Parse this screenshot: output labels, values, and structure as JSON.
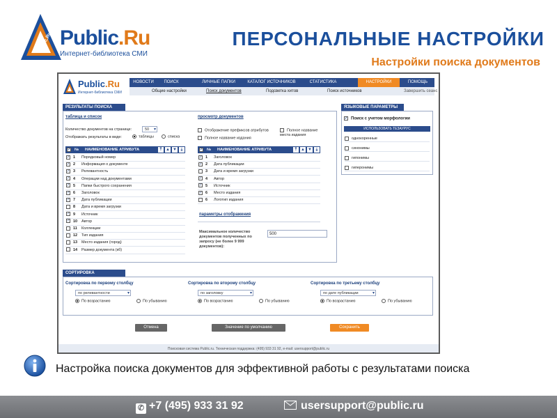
{
  "header": {
    "logo_brand": "Public.Ru",
    "logo_tag": "Public.Ru",
    "logo_subtitle": "Интернет-библиотека СМИ",
    "title": "ПЕРСОНАЛЬНЫЕ НАСТРОЙКИ",
    "subtitle": "Настройки поиска документов"
  },
  "app": {
    "logo_brand": "Public.Ru",
    "logo_subtitle": "Интернет-библиотека СМИ",
    "nav": [
      "НОВОСТИ",
      "ПОИСК",
      "ЛИЧНЫЕ ПАПКИ",
      "КАТАЛОГ ИСТОЧНИКОВ",
      "СТАТИСТИКА",
      "НАСТРОЙКИ",
      "ПОМОЩЬ"
    ],
    "nav_active": "НАСТРОЙКИ",
    "subnav": [
      "Общие настройки",
      "Поиск документов",
      "Подсветка хитов",
      "Поиск источников",
      "Завершить сеанс"
    ],
    "subnav_active": "Поиск документов",
    "results_section": {
      "header": "РЕЗУЛЬТАТЫ ПОИСКА",
      "table_title": "таблица и список",
      "count_label": "Количество документов на странице:",
      "count_value": "50",
      "display_label": "Отображать результаты в виде:",
      "display_options": [
        "таблицы",
        "списка"
      ],
      "display_selected": "таблицы",
      "column_no": "№",
      "column_attr": "НАИМЕНОВАНИЕ АТРИБУТА",
      "rows": [
        {
          "n": "1",
          "name": "Порядковый номер",
          "checked": true
        },
        {
          "n": "2",
          "name": "Информация о документе",
          "checked": true
        },
        {
          "n": "3",
          "name": "Релевантность",
          "checked": true
        },
        {
          "n": "4",
          "name": "Операции над документами",
          "checked": true
        },
        {
          "n": "5",
          "name": "Папки быстрого сохранения",
          "checked": true
        },
        {
          "n": "6",
          "name": "Заголовок",
          "checked": true
        },
        {
          "n": "7",
          "name": "Дата публикации",
          "checked": true
        },
        {
          "n": "8",
          "name": "Дата и время загрузки",
          "checked": false
        },
        {
          "n": "9",
          "name": "Источник",
          "checked": true
        },
        {
          "n": "10",
          "name": "Автор",
          "checked": true
        },
        {
          "n": "11",
          "name": "Коллекции",
          "checked": false
        },
        {
          "n": "12",
          "name": "Тип издания",
          "checked": false
        },
        {
          "n": "13",
          "name": "Место издания (город)",
          "checked": false
        },
        {
          "n": "14",
          "name": "Размер документа (кб)",
          "checked": false
        }
      ]
    },
    "view_section": {
      "title": "просмотр документов",
      "opt1": "Отображение префиксов атрибутов",
      "opt2": "Полное название места издания",
      "opt3": "Полное название издания",
      "column_no": "№",
      "column_attr": "НАИМЕНОВАНИЕ АТРИБУТА",
      "rows": [
        {
          "n": "1",
          "name": "Заголовок",
          "checked": true
        },
        {
          "n": "2",
          "name": "Дата публикации",
          "checked": true
        },
        {
          "n": "3",
          "name": "Дата и время загрузки",
          "checked": false
        },
        {
          "n": "4",
          "name": "Автор",
          "checked": true
        },
        {
          "n": "5",
          "name": "Источник",
          "checked": true
        },
        {
          "n": "6",
          "name": "Место издания",
          "checked": true
        },
        {
          "n": "6",
          "name": "Логотип издания",
          "checked": false
        }
      ],
      "display_title": "параметры отображения",
      "max_label": "Максимальное количество документов полученных по запросу (не более 9 999 документов):",
      "max_value": "500"
    },
    "lang_section": {
      "header": "ЯЗЫКОВЫЕ ПАРАМЕТРЫ",
      "morph": "Поиск с учетом морфологии",
      "thesaurus": "ИСПОЛЬЗОВАТЬ ТЕЗАУРУС",
      "items": [
        "однокоренные",
        "синонимы",
        "гипонимы",
        "гиперонимы"
      ]
    },
    "sort_section": {
      "header": "СОРТИРОВКА",
      "cols": [
        {
          "label": "Сортировка по первому столбцу",
          "value": "по релевантности",
          "asc": "По возрастанию",
          "desc": "По убыванию",
          "selected": "asc"
        },
        {
          "label": "Сортировка по второму столбцу",
          "value": "по заголовку",
          "asc": "По возрастанию",
          "desc": "По убыванию",
          "selected": "asc"
        },
        {
          "label": "Сортировка по третьему столбцу",
          "value": "по дате публикации",
          "asc": "По возрастанию",
          "desc": "По убыванию",
          "selected": "asc"
        }
      ]
    },
    "buttons": {
      "cancel": "Отмена",
      "defaults": "Значение по умолчанию",
      "save": "Сохранить"
    },
    "footer": "Поисковая система Public.ru. Техническая поддержка: (495) 933 31 92, e-mail: usersupport@public.ru"
  },
  "info": {
    "text": "Настройка поиска документов для эффективной работы с результатами поиска"
  },
  "contacts": {
    "phone": "+7 (495) 933 31 92",
    "email": "usersupport@public.ru"
  },
  "colors": {
    "brand_blue": "#1b4f9c",
    "accent_orange": "#e07a1a",
    "nav_blue": "#2b4c8c",
    "bar_gray": "#7a7c80"
  }
}
